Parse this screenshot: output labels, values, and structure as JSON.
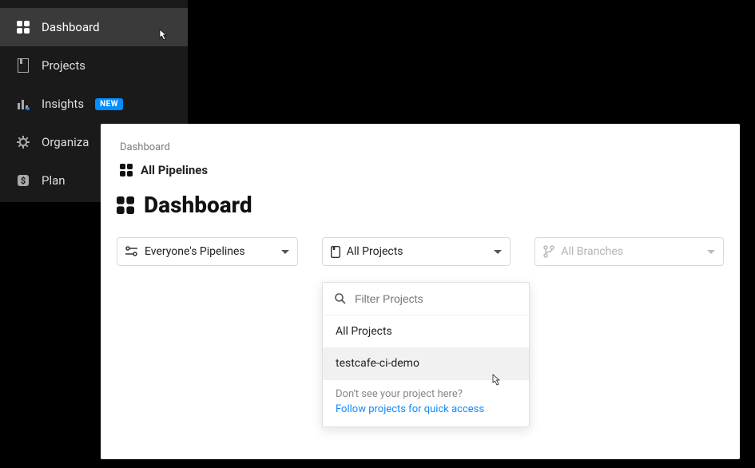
{
  "sidebar": {
    "items": [
      {
        "label": "Dashboard",
        "icon": "dashboard-icon"
      },
      {
        "label": "Projects",
        "icon": "projects-icon"
      },
      {
        "label": "Insights",
        "icon": "insights-icon",
        "badge": "NEW"
      },
      {
        "label": "Organiza",
        "icon": "gear-icon"
      },
      {
        "label": "Plan",
        "icon": "dollar-icon"
      }
    ]
  },
  "breadcrumb": "Dashboard",
  "subheading": "All Pipelines",
  "page_title": "Dashboard",
  "filters": {
    "pipelines": "Everyone's Pipelines",
    "projects": "All Projects",
    "branches": "All Branches"
  },
  "projects_menu": {
    "search_placeholder": "Filter Projects",
    "items": [
      "All Projects",
      "testcafe-ci-demo"
    ],
    "footer_text": "Don't see your project here?",
    "footer_link": "Follow projects for quick access"
  }
}
